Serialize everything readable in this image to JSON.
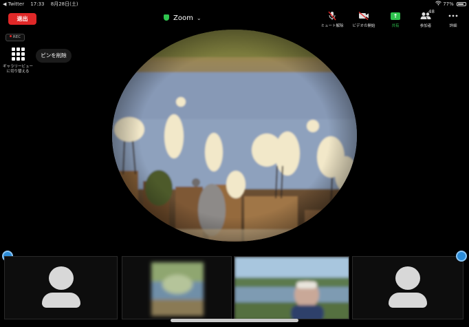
{
  "status_bar": {
    "back_app": "◀ Twitter",
    "time": "17:33",
    "date": "8月28日(土)",
    "battery_percent": "77%"
  },
  "toolbar": {
    "leave_label": "退出",
    "meeting_title": "Zoom",
    "items": [
      {
        "label": "ミュート解除",
        "icon": "mic-off-icon"
      },
      {
        "label": "ビデオの開始",
        "icon": "video-off-icon"
      },
      {
        "label": "共有",
        "icon": "share-icon"
      },
      {
        "label": "参加者",
        "icon": "participants-icon",
        "count": "48"
      },
      {
        "label": "詳細",
        "icon": "more-icon"
      }
    ]
  },
  "rec_badge": "REC",
  "gallery_view": {
    "label": "ギャラリービュー に切り替える"
  },
  "unpin_label": "ピンを削除",
  "colors": {
    "leave": "#e02828",
    "share": "#2fc44e",
    "pin": "#2b8cd8"
  },
  "thumbnails": [
    {
      "kind": "avatar"
    },
    {
      "kind": "video-blurred-landscape"
    },
    {
      "kind": "video-person-landscape"
    },
    {
      "kind": "avatar"
    }
  ]
}
